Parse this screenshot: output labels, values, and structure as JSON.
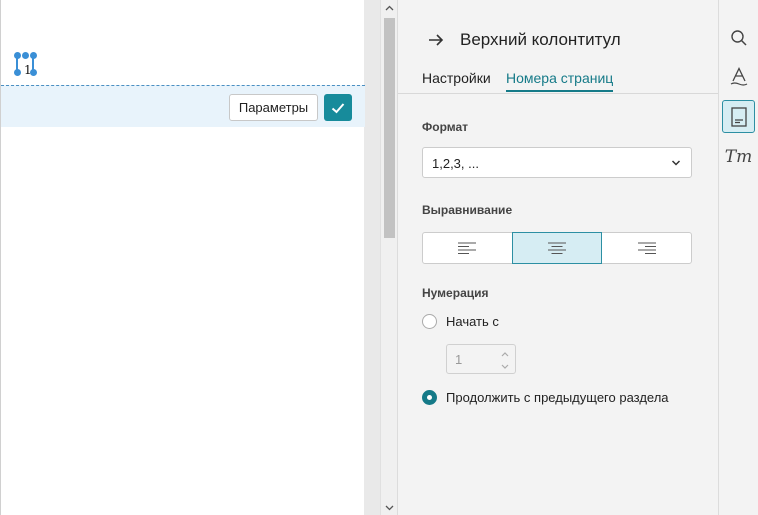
{
  "document": {
    "page_number_field": "1",
    "params_button": "Параметры"
  },
  "panel": {
    "title": "Верхний колонтитул",
    "tabs": [
      {
        "label": "Настройки",
        "active": false
      },
      {
        "label": "Номера страниц",
        "active": true
      }
    ],
    "format": {
      "label": "Формат",
      "selected": "1,2,3, ..."
    },
    "alignment": {
      "label": "Выравнивание",
      "options": [
        "align-left",
        "align-center",
        "align-right"
      ],
      "selected": "align-center"
    },
    "numbering": {
      "label": "Нумерация",
      "start_from_label": "Начать с",
      "start_value": "1",
      "continue_label": "Продолжить с предыдущего раздела",
      "selected": "continue"
    }
  },
  "rail": {
    "icons": [
      "search-icon",
      "text-style-icon",
      "header-footer-icon",
      "font-icon"
    ],
    "active": "header-footer-icon",
    "font_icon_text": "Tт"
  },
  "colors": {
    "accent": "#157a88",
    "header_region": "#e8f3fb",
    "guide_line": "#4a8fc2"
  }
}
